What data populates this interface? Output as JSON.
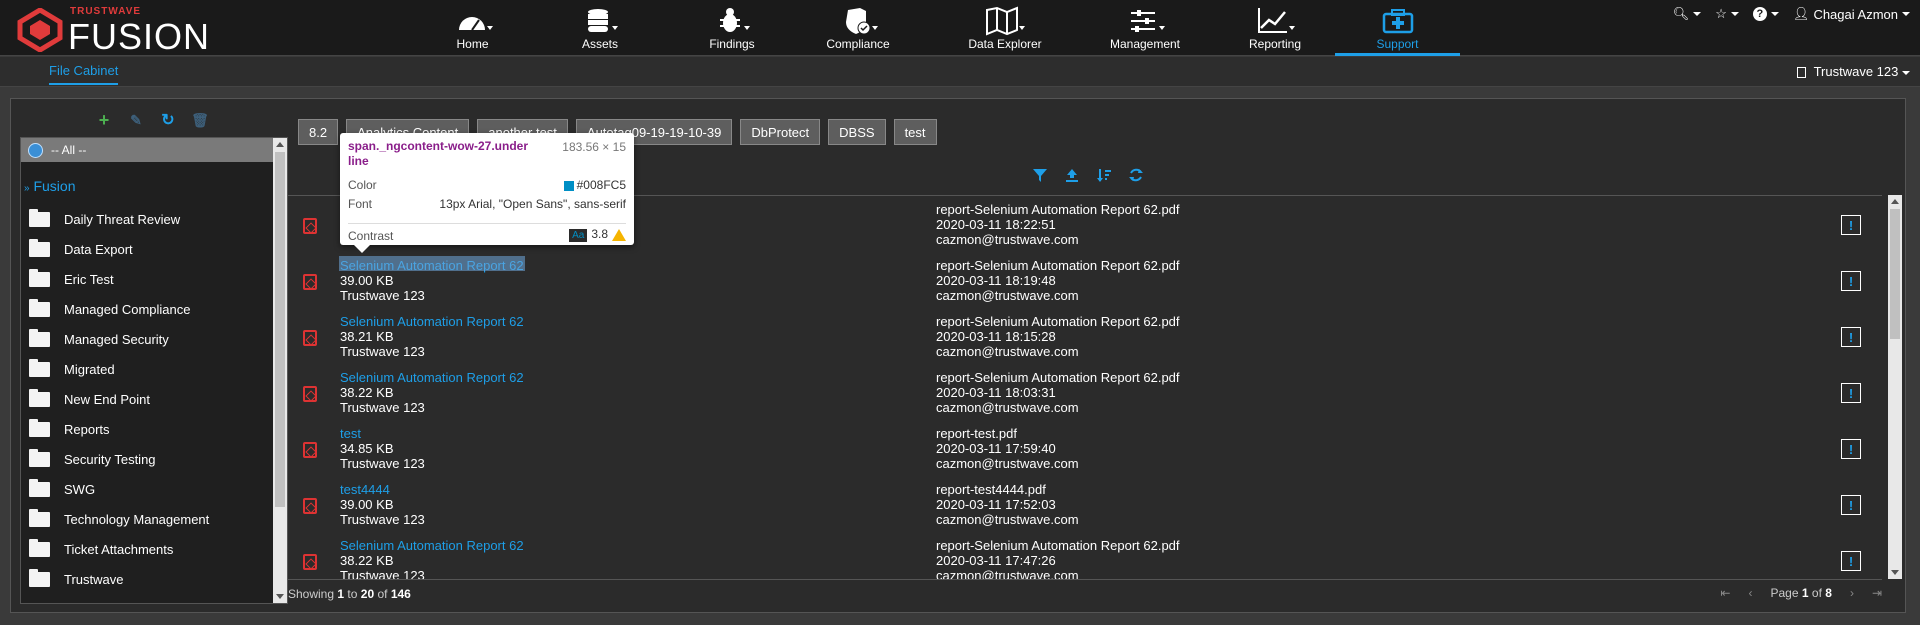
{
  "brand": {
    "small": "TRUSTWAVE",
    "name": "FUSION",
    "accent": "#e03b3b"
  },
  "nav": [
    {
      "label": "Home",
      "icon": "dashboard-icon"
    },
    {
      "label": "Assets",
      "icon": "database-icon"
    },
    {
      "label": "Findings",
      "icon": "bug-icon"
    },
    {
      "label": "Compliance",
      "icon": "shield-check-icon"
    },
    {
      "label": "Data Explorer",
      "icon": "map-icon"
    },
    {
      "label": "Management",
      "icon": "sliders-icon"
    },
    {
      "label": "Reporting",
      "icon": "line-chart-icon"
    },
    {
      "label": "Support",
      "icon": "medkit-icon",
      "active": true
    }
  ],
  "user": {
    "name": "Chagai Azmon"
  },
  "subbar": {
    "tab": "File Cabinet",
    "org": "Trustwave 123"
  },
  "tree": {
    "all": "-- All --",
    "root": "Fusion",
    "folders": [
      "Daily Threat Review",
      "Data Export",
      "Eric Test",
      "Managed Compliance",
      "Managed Security",
      "Migrated",
      "New End Point",
      "Reports",
      "Security Testing",
      "SWG",
      "Technology Management",
      "Ticket Attachments",
      "Trustwave"
    ]
  },
  "tags": [
    "8.2",
    "Analytics Content",
    "another test",
    "Autotag09-19-19-10-39",
    "DbProtect",
    "DBSS",
    "test"
  ],
  "rows": [
    {
      "name": "",
      "size": "",
      "org": "",
      "file": "report-Selenium Automation Report 62.pdf",
      "date": "2020-03-11 18:22:51",
      "user": "cazmon@trustwave.com"
    },
    {
      "name": "Selenium Automation Report 62",
      "size": "39.00 KB",
      "org": "Trustwave 123",
      "file": "report-Selenium Automation Report 62.pdf",
      "date": "2020-03-11 18:19:48",
      "user": "cazmon@trustwave.com"
    },
    {
      "name": "Selenium Automation Report 62",
      "size": "38.21 KB",
      "org": "Trustwave 123",
      "file": "report-Selenium Automation Report 62.pdf",
      "date": "2020-03-11 18:15:28",
      "user": "cazmon@trustwave.com"
    },
    {
      "name": "Selenium Automation Report 62",
      "size": "38.22 KB",
      "org": "Trustwave 123",
      "file": "report-Selenium Automation Report 62.pdf",
      "date": "2020-03-11 18:03:31",
      "user": "cazmon@trustwave.com"
    },
    {
      "name": "test",
      "size": "34.85 KB",
      "org": "Trustwave 123",
      "file": "report-test.pdf",
      "date": "2020-03-11 17:59:40",
      "user": "cazmon@trustwave.com"
    },
    {
      "name": "test4444",
      "size": "39.00 KB",
      "org": "Trustwave 123",
      "file": "report-test4444.pdf",
      "date": "2020-03-11 17:52:03",
      "user": "cazmon@trustwave.com"
    },
    {
      "name": "Selenium Automation Report 62",
      "size": "38.22 KB",
      "org": "Trustwave 123",
      "file": "report-Selenium Automation Report 62.pdf",
      "date": "2020-03-11 17:47:26",
      "user": "cazmon@trustwave.com"
    }
  ],
  "footer": {
    "showing": "Showing",
    "from": "1",
    "to_word": "to",
    "to": "20",
    "of_word": "of",
    "total": "146",
    "page_word": "Page",
    "page": "1",
    "page_of": "of",
    "pages": "8"
  },
  "tooltip": {
    "selector": "span._ngcontent-wow-27.underline",
    "dims": "183.56 × 15",
    "color_label": "Color",
    "color_value": "#008FC5",
    "font_label": "Font",
    "font_value": "13px Arial, \"Open Sans\", sans-serif",
    "contrast_label": "Contrast",
    "contrast_badge": "Aa",
    "contrast_value": "3.8"
  },
  "colors": {
    "link": "#1e9fe8",
    "bg": "#2b2b2b",
    "pdf": "#d33333"
  }
}
